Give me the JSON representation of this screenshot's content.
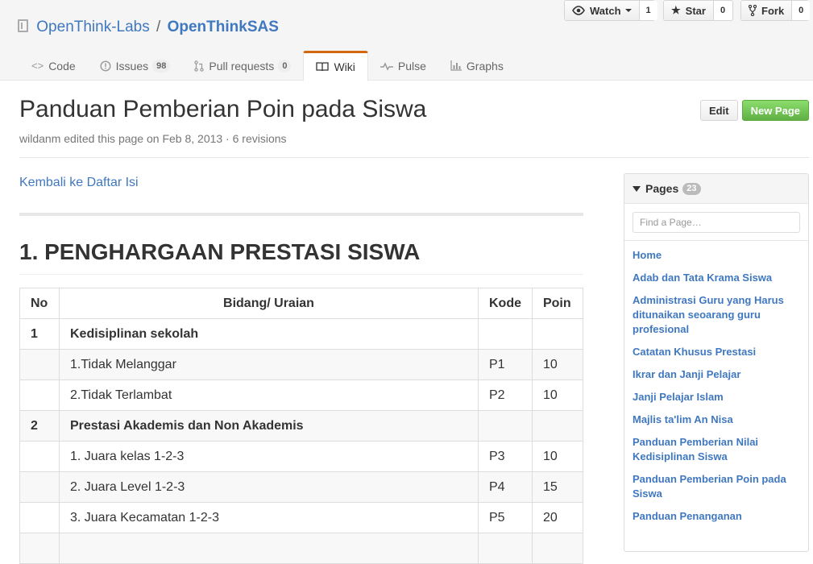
{
  "repo": {
    "owner": "OpenThink-Labs",
    "separator": "/",
    "name": "OpenThinkSAS"
  },
  "actions": {
    "watch": {
      "label": "Watch",
      "count": "1"
    },
    "star": {
      "label": "Star",
      "count": "0"
    },
    "fork": {
      "label": "Fork",
      "count": "0"
    }
  },
  "nav": {
    "code": {
      "label": "Code"
    },
    "issues": {
      "label": "Issues",
      "count": "98"
    },
    "pulls": {
      "label": "Pull requests",
      "count": "0"
    },
    "wiki": {
      "label": "Wiki"
    },
    "pulse": {
      "label": "Pulse"
    },
    "graphs": {
      "label": "Graphs"
    }
  },
  "page": {
    "title": "Panduan Pemberian Poin pada Siswa",
    "meta": "wildanm edited this page on Feb 8, 2013 · 6 revisions",
    "edit_label": "Edit",
    "new_page_label": "New Page"
  },
  "content": {
    "back_link": "Kembali ke Daftar Isi",
    "section_title": "1. PENGHARGAAN PRESTASI SISWA",
    "table": {
      "headers": [
        "No",
        "Bidang/ Uraian",
        "Kode",
        "Poin"
      ],
      "rows": [
        [
          "1",
          "Kedisiplinan sekolah",
          "",
          ""
        ],
        [
          "",
          "1.Tidak Melanggar",
          "P1",
          "10"
        ],
        [
          "",
          "2.Tidak Terlambat",
          "P2",
          "10"
        ],
        [
          "2",
          "Prestasi Akademis dan Non Akademis",
          "",
          ""
        ],
        [
          "",
          "1. Juara kelas 1-2-3",
          "P3",
          "10"
        ],
        [
          "",
          "2. Juara Level 1-2-3",
          "P4",
          "15"
        ],
        [
          "",
          "3. Juara Kecamatan 1-2-3",
          "P5",
          "20"
        ],
        [
          "",
          "",
          "",
          ""
        ]
      ]
    }
  },
  "sidebar": {
    "title": "Pages",
    "count": "23",
    "filter_placeholder": "Find a Page…",
    "pages": [
      "Home",
      "Adab dan Tata Krama Siswa",
      "Administrasi Guru yang Harus ditunaikan seoarang guru profesional",
      "Catatan Khusus Prestasi",
      "Ikrar dan Janji Pelajar",
      "Janji Pelajar Islam",
      "Majlis ta'lim An Nisa",
      "Panduan Pemberian Nilai Kedisiplinan Siswa",
      "Panduan Pemberian Poin pada Siswa",
      "Panduan Penanganan"
    ]
  },
  "colors": {
    "link": "#4078c0",
    "wiki_tab_accent": "#d26911",
    "new_page_button": "#60b044"
  },
  "icons": {
    "repo": "repo-icon",
    "watch": "eye-icon",
    "star": "star-icon",
    "fork": "fork-icon",
    "code": "code-icon",
    "issues": "issue-icon",
    "pulls": "pull-request-icon",
    "wiki": "book-icon",
    "pulse": "pulse-icon",
    "graphs": "graph-icon",
    "pages": "triangle-down-icon"
  }
}
